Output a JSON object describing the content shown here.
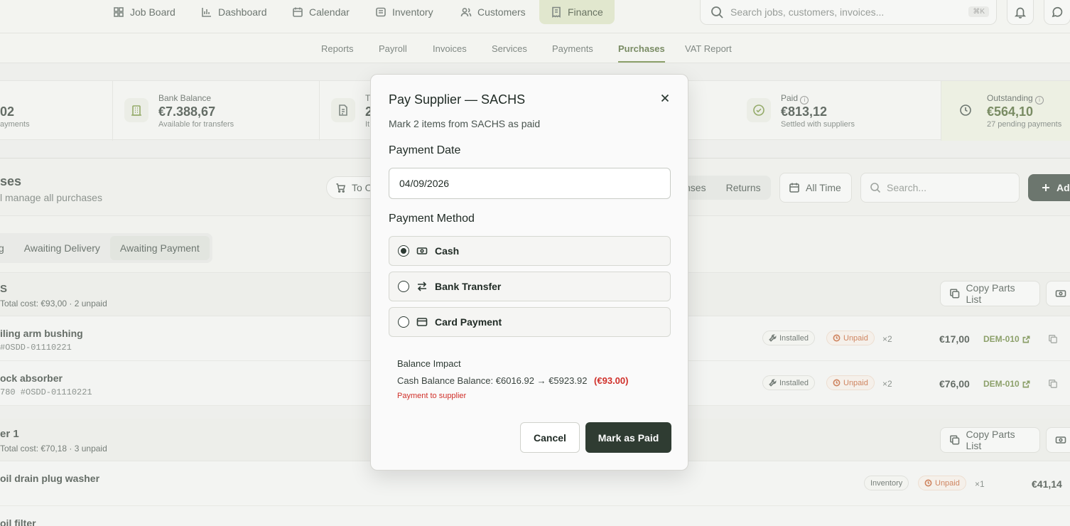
{
  "nav": {
    "items": [
      {
        "label": "Job Board",
        "icon": "grid-icon"
      },
      {
        "label": "Dashboard",
        "icon": "bar-chart-icon"
      },
      {
        "label": "Calendar",
        "icon": "calendar-icon"
      },
      {
        "label": "Inventory",
        "icon": "box-icon"
      },
      {
        "label": "Customers",
        "icon": "users-icon"
      },
      {
        "label": "Finance",
        "icon": "receipt-icon",
        "active": true
      }
    ],
    "search_placeholder": "Search jobs, customers, invoices...",
    "search_kbd": "⌘K"
  },
  "subnav": {
    "tabs": [
      "Reports",
      "Payroll",
      "Invoices",
      "Services",
      "Payments",
      "Purchases",
      "VAT Report"
    ],
    "active": "Purchases"
  },
  "stats": {
    "first": {
      "value": "02",
      "sub": "ayments"
    },
    "bank": {
      "label": "Bank Balance",
      "value": "€7.388,67",
      "sub": "Available for transfers"
    },
    "third": {
      "label": "T",
      "value": "2",
      "sub": "It"
    },
    "paid": {
      "label": "Paid",
      "value": "€813,12",
      "sub": "Settled with suppliers"
    },
    "outstanding": {
      "label": "Outstanding",
      "value": "€564,10",
      "sub": "27 pending payments"
    }
  },
  "page": {
    "title": "ses",
    "subtitle": "l manage all purchases",
    "to_pill": "To O",
    "seg_left": "nses",
    "seg_right": "Returns",
    "time_filter": "All Time",
    "search_placeholder": "Search...",
    "add_label": "Ad"
  },
  "filters": {
    "tabs": [
      "g",
      "Awaiting Delivery",
      "Awaiting Payment"
    ],
    "active": "Awaiting Payment"
  },
  "groups": [
    {
      "title": "S",
      "sub": "Total cost: €93,00 · 2 unpaid",
      "copy_label": "Copy Parts List",
      "items": [
        {
          "name": "iling arm bushing",
          "ref": "#OSDD-01110221",
          "status": "Installed",
          "payment": "Unpaid",
          "qty": "×2",
          "price": "€17,00",
          "job": "DEM-010"
        },
        {
          "name": "ock absorber",
          "ref": "780 #OSDD-01110221",
          "status": "Installed",
          "payment": "Unpaid",
          "qty": "×2",
          "price": "€76,00",
          "job": "DEM-010"
        }
      ]
    },
    {
      "title": "er 1",
      "sub": "Total cost: €70,18 · 3 unpaid",
      "copy_label": "Copy Parts List",
      "items": [
        {
          "name": "oil drain plug washer",
          "ref": "",
          "status": "Inventory",
          "payment": "Unpaid",
          "qty": "×1",
          "price": "€41,14",
          "job": ""
        },
        {
          "name": "oil filter",
          "ref": "",
          "status": "",
          "payment": "",
          "qty": "",
          "price": "",
          "job": ""
        }
      ]
    }
  ],
  "modal": {
    "title": "Pay Supplier — SACHS",
    "description": "Mark 2 items from SACHS as paid",
    "date_label": "Payment Date",
    "date_value": "04/09/2026",
    "method_label": "Payment Method",
    "methods": [
      {
        "label": "Cash",
        "icon": "banknote-icon",
        "selected": true
      },
      {
        "label": "Bank Transfer",
        "icon": "arrows-swap-icon",
        "selected": false
      },
      {
        "label": "Card Payment",
        "icon": "credit-card-icon",
        "selected": false
      }
    ],
    "impact_title": "Balance Impact",
    "impact_line": "Cash Balance Balance: €6016.92 → €5923.92",
    "impact_delta": "(€93.00)",
    "impact_note": "Payment to supplier",
    "cancel_label": "Cancel",
    "confirm_label": "Mark as Paid"
  },
  "colors": {
    "accent": "#5c7a2a",
    "dark_button": "#2f3c32",
    "danger": "#d0302a",
    "unpaid": "#c4501b"
  }
}
